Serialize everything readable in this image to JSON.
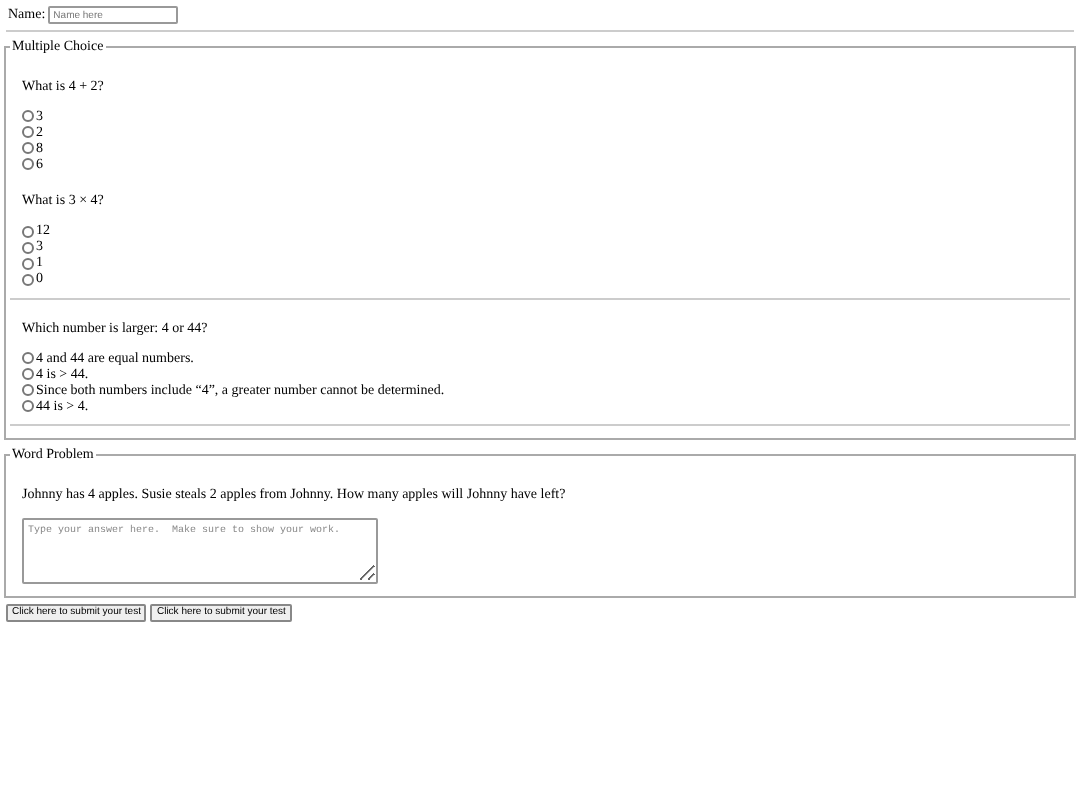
{
  "name_field": {
    "label": "Name:",
    "placeholder": "Name here"
  },
  "multiple_choice": {
    "legend": "Multiple Choice",
    "questions": [
      {
        "text": "What is 4 + 2?",
        "rule_after": false,
        "options": [
          {
            "label": "3",
            "selected": false
          },
          {
            "label": "2",
            "selected": false
          },
          {
            "label": "8",
            "selected": false
          },
          {
            "label": "6",
            "selected": false
          }
        ]
      },
      {
        "text": "What is 3 × 4?",
        "rule_after": true,
        "options": [
          {
            "label": "12",
            "selected": false
          },
          {
            "label": "3",
            "selected": false
          },
          {
            "label": "1",
            "selected": false
          },
          {
            "label": "0",
            "selected": false
          }
        ]
      },
      {
        "text": "Which number is larger: 4 or 44?",
        "rule_after": true,
        "options": [
          {
            "label": "4 and 44 are equal numbers.",
            "selected": false
          },
          {
            "label": "4 is > 44.",
            "selected": false
          },
          {
            "label": "Since both numbers include “4”, a greater number cannot be determined.",
            "selected": false
          },
          {
            "label": "44 is > 4.",
            "selected": false
          }
        ]
      }
    ]
  },
  "word_problem": {
    "legend": "Word Problem",
    "text": "Johnny has 4 apples. Susie steals 2 apples from Johnny. How many apples will Johnny have left?",
    "answer_placeholder": "Type your answer here.  Make sure to show your work."
  },
  "buttons": [
    "Click here to submit your test",
    "Click here to submit your test"
  ]
}
